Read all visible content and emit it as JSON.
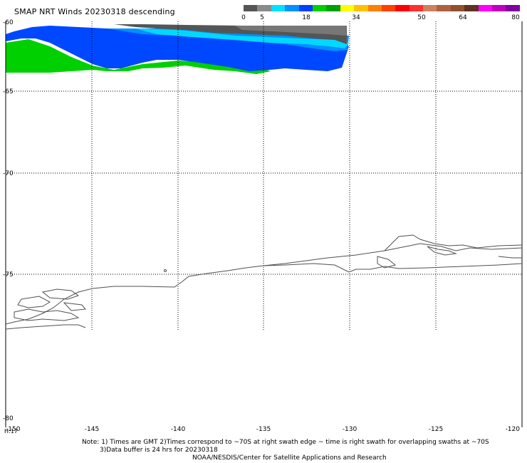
{
  "title": "SMAP NRT Winds  20230318 descending",
  "colorbar": {
    "labels": [
      "0",
      "5",
      "18",
      "34",
      "50",
      "64",
      "80"
    ],
    "segments": [
      {
        "color": "#555555"
      },
      {
        "color": "#8a8a8a"
      },
      {
        "color": "#00e0ff"
      },
      {
        "color": "#0090ff"
      },
      {
        "color": "#0040ff"
      },
      {
        "color": "#00d000"
      },
      {
        "color": "#00a000"
      },
      {
        "color": "#ffff00"
      },
      {
        "color": "#ffc000"
      },
      {
        "color": "#ff8000"
      },
      {
        "color": "#ff4000"
      },
      {
        "color": "#ff0000"
      },
      {
        "color": "#ff3030"
      },
      {
        "color": "#d08060"
      },
      {
        "color": "#b06040"
      },
      {
        "color": "#905030"
      },
      {
        "color": "#603020"
      },
      {
        "color": "#ff00ff"
      },
      {
        "color": "#c000c0"
      },
      {
        "color": "#8000a0"
      }
    ]
  },
  "map": {
    "lat_labels": [
      "-60",
      "-65",
      "-70",
      "-75",
      "-80"
    ],
    "lon_labels": [
      "-150",
      "-145",
      "-140",
      "-135",
      "-130",
      "-125",
      "-120"
    ],
    "time_label": "H:17"
  },
  "notes": {
    "line1": "Note: 1) Times are GMT 2)Times correspond to ~70S at right swath edge ~ time is right swath for overlapping swaths at ~70S",
    "line2": "3)Data buffer is 24 hrs for 20230318",
    "line3": "NOAA/NESDIS/Center for Satellite Applications and Research"
  },
  "colors": {
    "swath_calm": "#555555",
    "swath_low": "#0040ff",
    "swath_mid": "#00e0ff",
    "swath_high": "#00d000",
    "grid": "#000000",
    "coast": "#505050"
  }
}
